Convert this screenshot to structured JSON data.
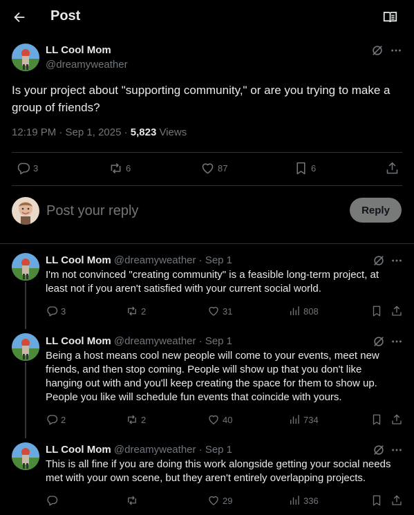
{
  "header": {
    "title": "Post",
    "back_icon": "arrow-left-icon",
    "reader_icon": "open-book-icon"
  },
  "post": {
    "author_name": "LL Cool Mom",
    "author_handle": "@dreamyweather",
    "text": "Is your project about \"supporting community,\" or are you trying to make a group of friends?",
    "time": "12:19 PM · Sep 1, 2025 · ",
    "views_count": "5,823",
    "views_label": " Views",
    "actions": {
      "replies": "3",
      "reposts": "6",
      "likes": "87",
      "bookmarks": "6"
    }
  },
  "compose": {
    "placeholder": "Post your reply",
    "button_label": "Reply"
  },
  "replies": [
    {
      "name": "LL Cool Mom",
      "handle": "@dreamyweather",
      "date": " · Sep 1",
      "text": "I'm not convinced \"creating community\" is a feasible long-term project, at least not if you aren't satisfied with your current social world.",
      "replies": "3",
      "reposts": "2",
      "likes": "31",
      "views": "808"
    },
    {
      "name": "LL Cool Mom",
      "handle": "@dreamyweather",
      "date": " · Sep 1",
      "text": "Being a host means cool new people will come to your events, meet new friends, and then stop coming. People will show up that you don't like hanging out with and you'll keep creating the space for them to show up. People you like will schedule fun events that coincide with yours.",
      "replies": "2",
      "reposts": "2",
      "likes": "40",
      "views": "734"
    },
    {
      "name": "LL Cool Mom",
      "handle": "@dreamyweather",
      "date": " · Sep 1",
      "text": "This is all fine if you are doing this work alongside getting your social needs met with your own scene, but they aren't entirely overlapping projects.",
      "replies": "",
      "reposts": "",
      "likes": "29",
      "views": "336"
    }
  ],
  "colors": {
    "background": "#000000",
    "text": "#e7e9ea",
    "muted": "#71767b",
    "divider": "#2f3336",
    "reply_button": "#787a7a"
  }
}
